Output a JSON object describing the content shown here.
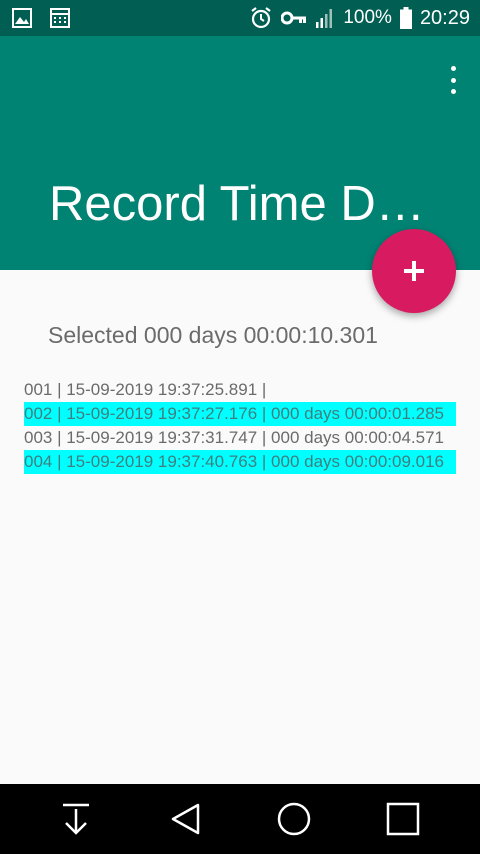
{
  "status_bar": {
    "battery_text": "100%",
    "time": "20:29",
    "left_icons": [
      "image-icon",
      "calendar-icon"
    ],
    "right_icons": [
      "alarm-icon",
      "key-icon",
      "signal-icon",
      "battery-icon"
    ]
  },
  "app_bar": {
    "title": "Record Time Dr…",
    "menu_icon": "overflow-menu-icon",
    "color": "#008373",
    "status_color": "#005e52"
  },
  "fab": {
    "icon": "plus-icon",
    "color": "#d81b60"
  },
  "summary": {
    "text": "Selected 000 days 00:00:10.301"
  },
  "records": [
    {
      "text": "001 | 15-09-2019 19:37:25.891 |",
      "selected": false
    },
    {
      "text": "002 | 15-09-2019 19:37:27.176 | 000 days 00:00:01.285",
      "selected": true
    },
    {
      "text": "003 | 15-09-2019 19:37:31.747 | 000 days 00:00:04.571",
      "selected": false
    },
    {
      "text": "004 | 15-09-2019 19:37:40.763 | 000 days 00:00:09.016",
      "selected": true
    }
  ],
  "highlight_color": "#00ffff",
  "nav_bar": {
    "buttons": [
      "download-icon",
      "back-icon",
      "home-icon",
      "recents-icon"
    ]
  }
}
